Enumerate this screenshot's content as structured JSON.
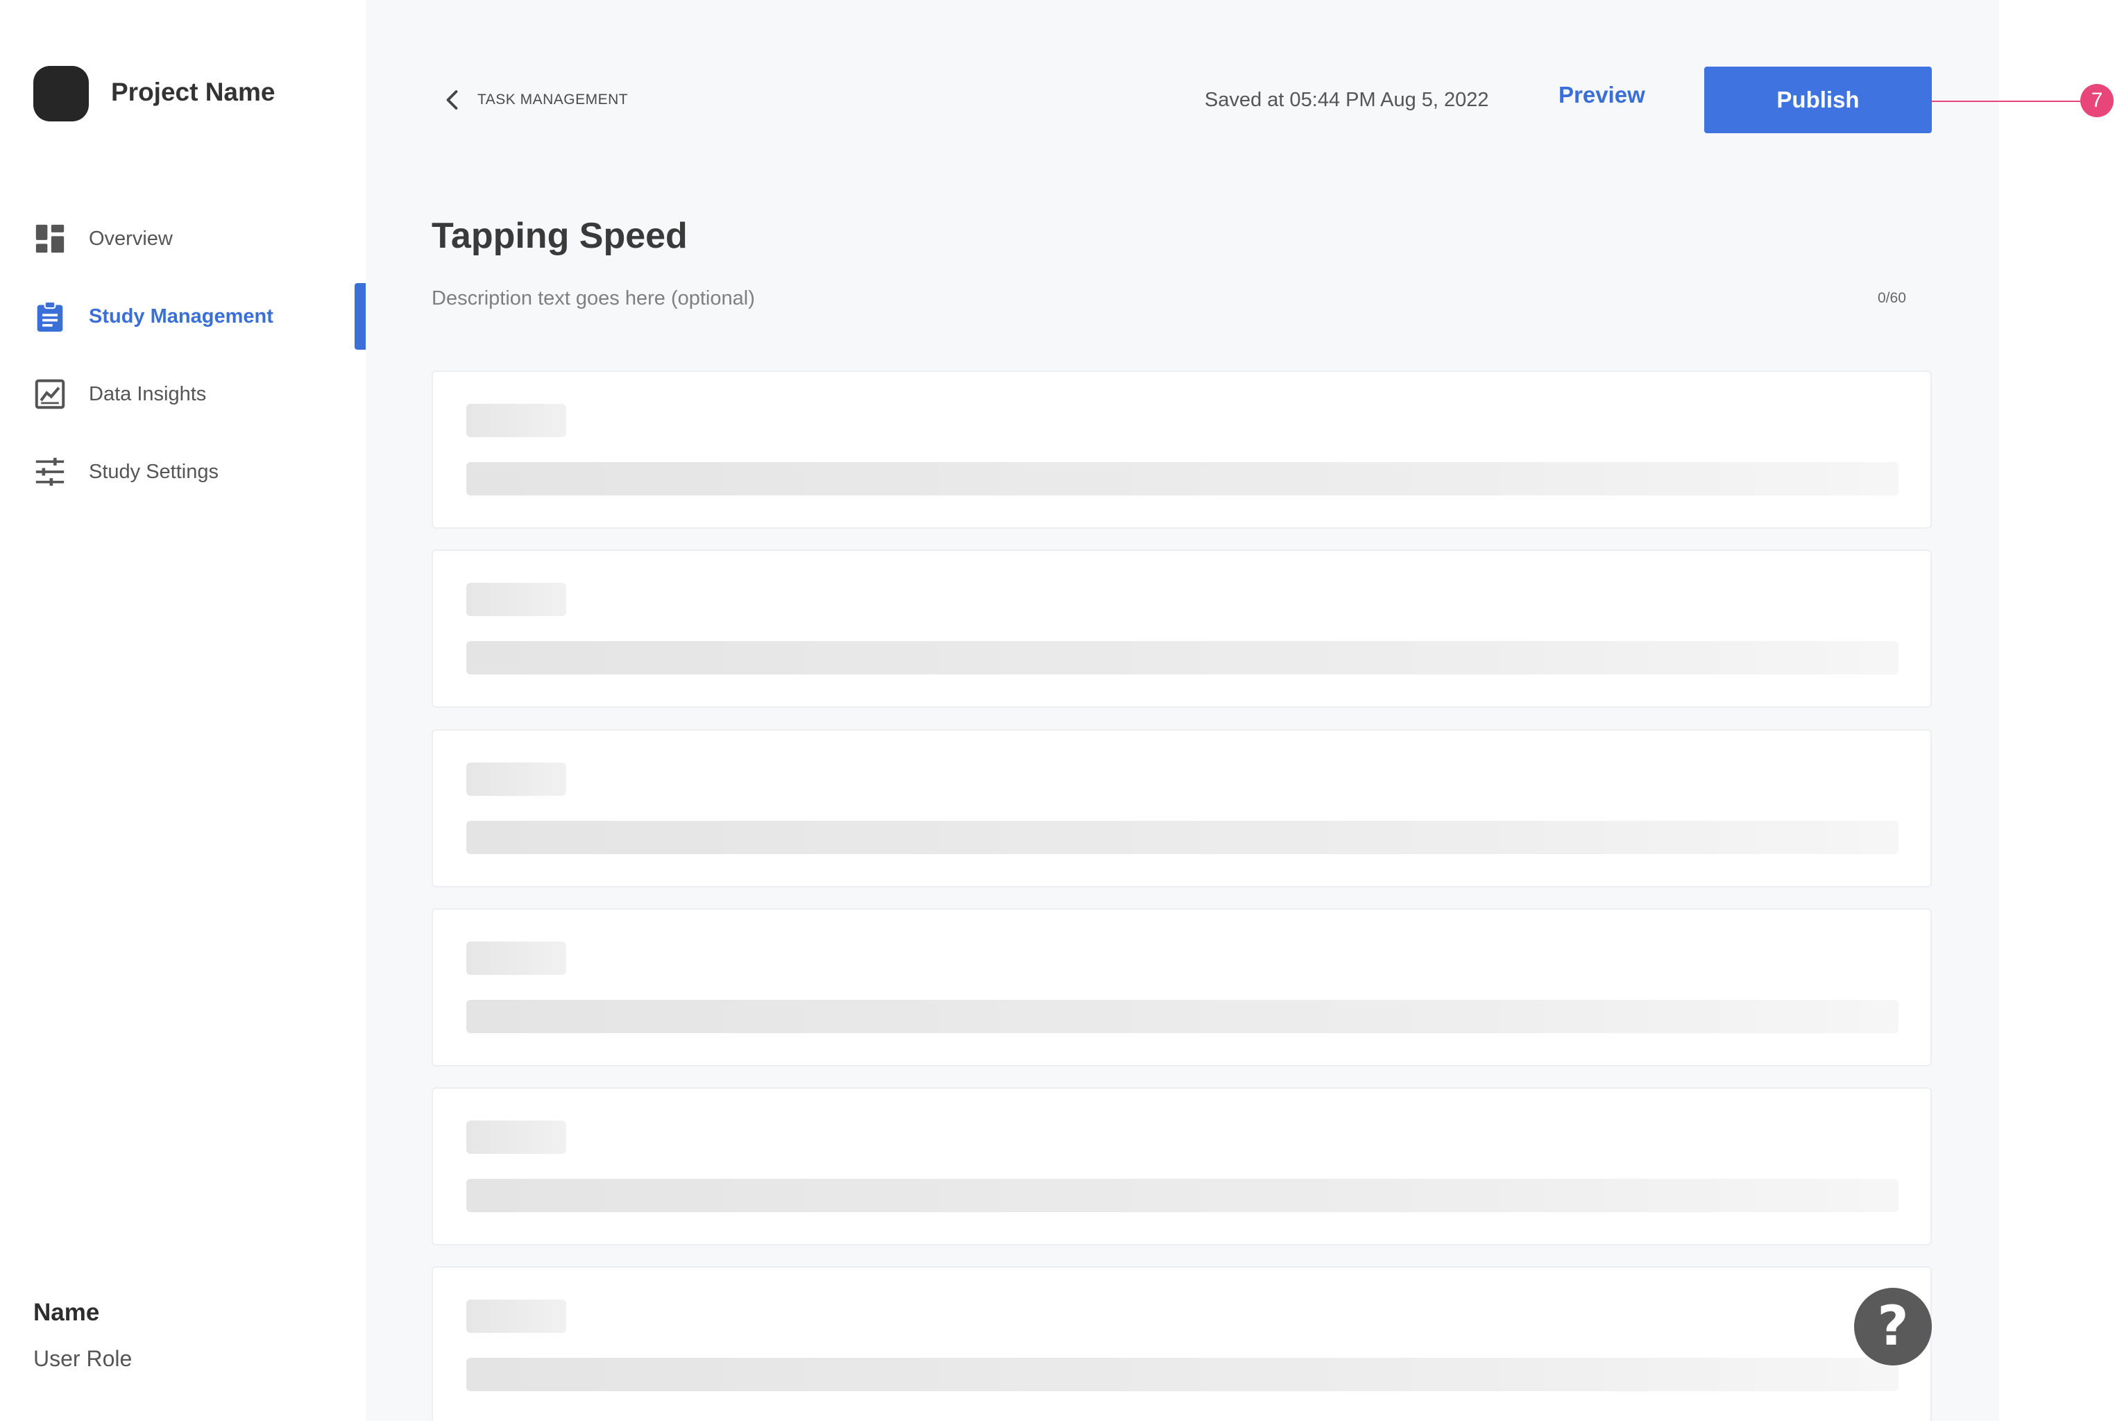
{
  "sidebar": {
    "project_name": "Project Name",
    "items": [
      {
        "label": "Overview",
        "icon": "dashboard-icon"
      },
      {
        "label": "Study Management",
        "icon": "clipboard-icon",
        "active": true
      },
      {
        "label": "Data Insights",
        "icon": "chart-icon"
      },
      {
        "label": "Study Settings",
        "icon": "sliders-icon"
      }
    ],
    "user": {
      "name": "Name",
      "role": "User Role"
    }
  },
  "header": {
    "breadcrumb": "TASK MANAGEMENT",
    "saved_text": "Saved at 05:44 PM Aug 5, 2022",
    "preview_label": "Preview",
    "publish_label": "Publish",
    "annotation_number": "7"
  },
  "main": {
    "title": "Tapping Speed",
    "description_placeholder": "Description text goes here (optional)",
    "char_count": "0/60"
  },
  "colors": {
    "accent": "#3e73e0",
    "annotation": "#e8457a",
    "background": "#f7f8fa"
  }
}
